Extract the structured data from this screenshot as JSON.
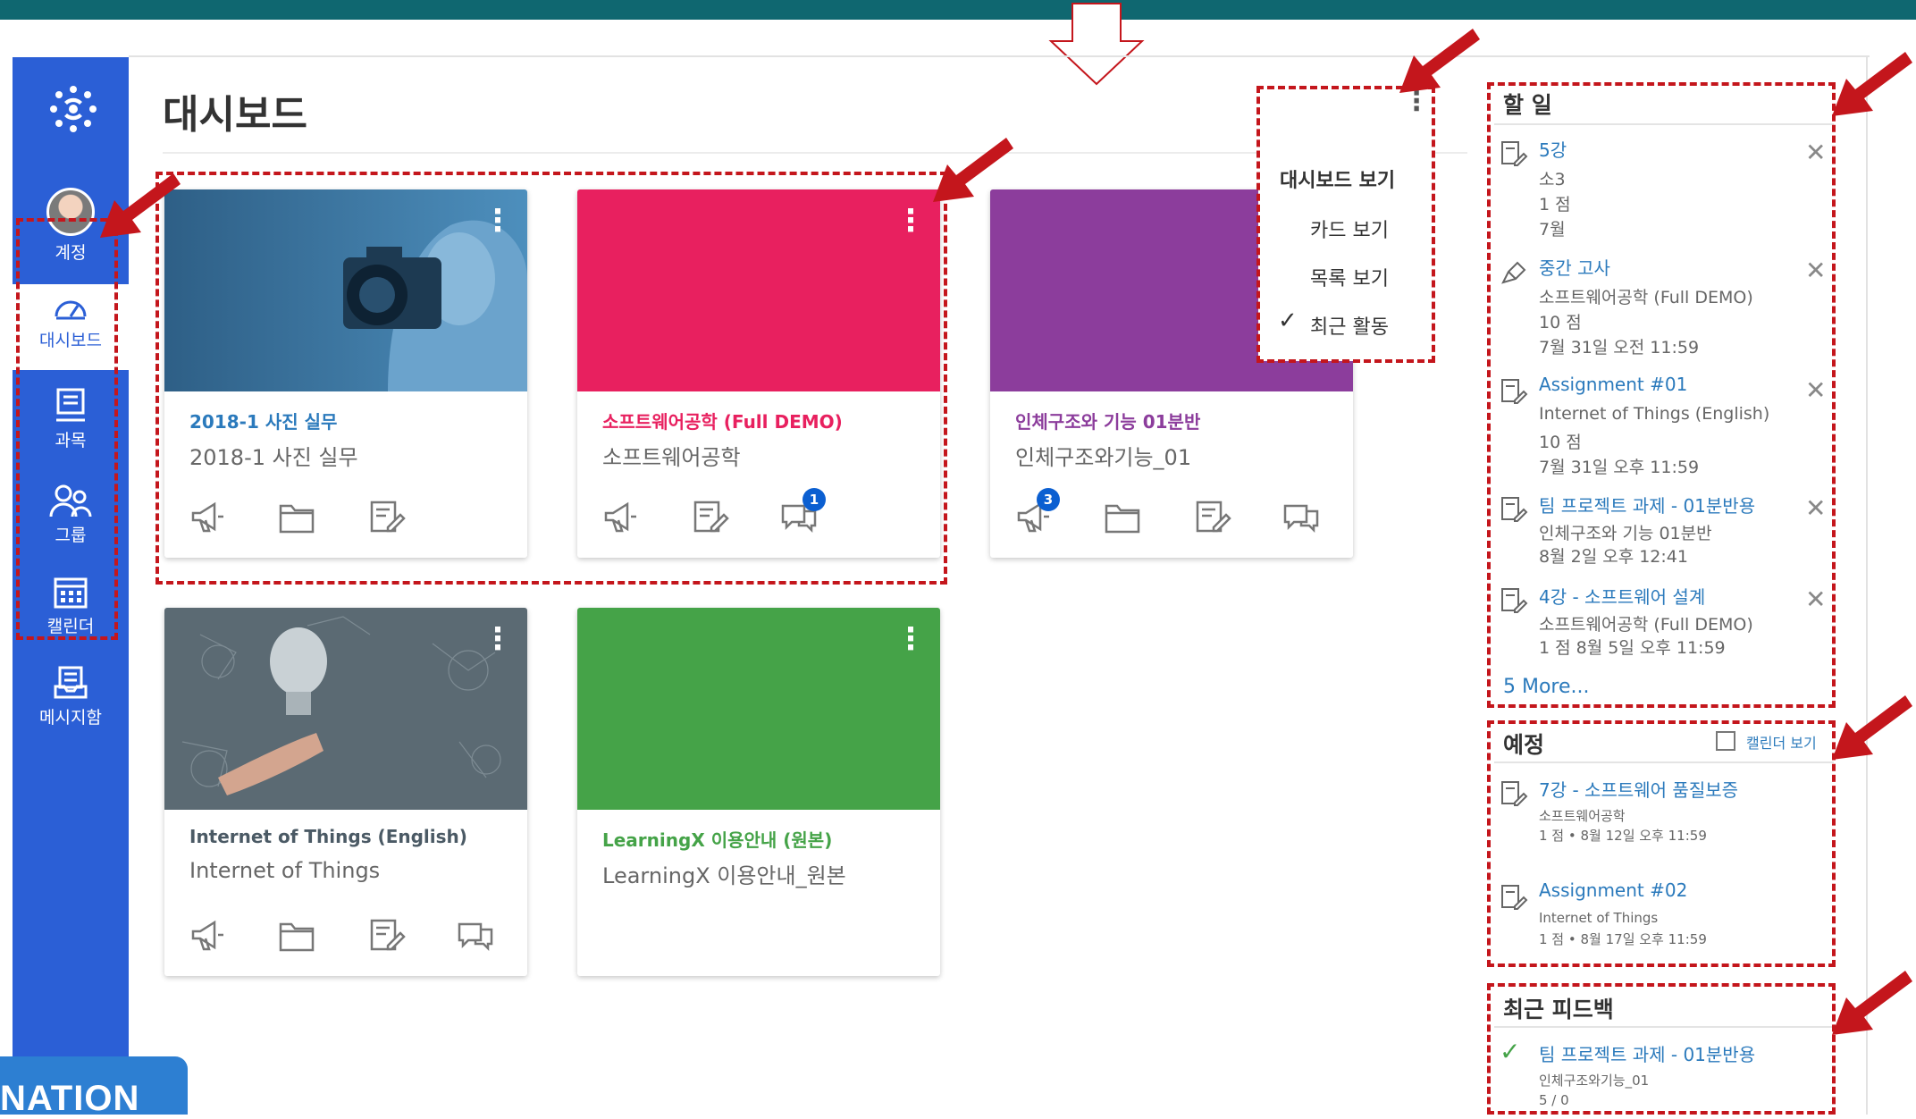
{
  "colors": {
    "top_bar": "#0f6770",
    "global_nav": "#2b5fd6",
    "card_pink": "#e8205f",
    "card_purple": "#8c3d9c",
    "card_green": "#45a348",
    "link": "#2b7abc",
    "highlight": "#c4161c"
  },
  "global_nav": {
    "items": [
      {
        "label": "계정",
        "icon": "avatar"
      },
      {
        "label": "대시보드",
        "icon": "dashboard-icon"
      },
      {
        "label": "과목",
        "icon": "courses-icon"
      },
      {
        "label": "그룹",
        "icon": "groups-icon"
      },
      {
        "label": "캘린더",
        "icon": "calendar-icon"
      },
      {
        "label": "메시지함",
        "icon": "inbox-icon"
      }
    ],
    "overlay_label": "NATION"
  },
  "page_title": "대시보드",
  "cards": [
    {
      "title": "2018-1 사진 실무",
      "subtitle": "2018-1 사진 실무",
      "title_color": "#2b7abc",
      "hero": "photo-camera",
      "icons": [
        "announcements-icon",
        "files-icon",
        "assignments-icon"
      ],
      "badge": ""
    },
    {
      "title": "소프트웨어공학 (Full DEMO)",
      "subtitle": "소프트웨어공학",
      "title_color": "#e8205f",
      "hero": "#e8205f",
      "icons": [
        "announcements-icon",
        "assignments-icon",
        "discussions-icon"
      ],
      "badge": "1"
    },
    {
      "title": "인체구조와 기능 01분반",
      "subtitle": "인체구조와기능_01",
      "title_color": "#8c3d9c",
      "hero": "#8c3d9c",
      "icons": [
        "announcements-icon",
        "files-icon",
        "assignments-icon",
        "discussions-icon"
      ],
      "badge": "3"
    },
    {
      "title": "Internet of Things (English)",
      "subtitle": "Internet of Things",
      "title_color": "#4b5a65",
      "hero": "photo-bulb",
      "icons": [
        "announcements-icon",
        "files-icon",
        "assignments-icon",
        "discussions-icon"
      ],
      "badge": ""
    },
    {
      "title": "LearningX 이용안내 (원본)",
      "subtitle": "LearningX 이용안내_원본",
      "title_color": "#45a348",
      "hero": "#45a348",
      "icons": [],
      "badge": ""
    }
  ],
  "view_menu": {
    "heading": "대시보드 보기",
    "options": [
      "카드 보기",
      "목록 보기",
      "최근 활동"
    ],
    "selected": "최근 활동"
  },
  "todo": {
    "heading": "할 일",
    "items": [
      {
        "title": "5강",
        "lines": [
          "소3",
          "1 점",
          "7월"
        ]
      },
      {
        "title": "중간 고사",
        "lines": [
          "소프트웨어공학 (Full DEMO)",
          "10 점",
          "7월 31일 오전 11:59"
        ]
      },
      {
        "title": "Assignment #01",
        "lines": [
          "Internet of Things (English)",
          "10 점",
          "7월 31일 오후 11:59"
        ]
      },
      {
        "title": "팀 프로젝트 과제 - 01분반용",
        "lines": [
          "인체구조와 기능 01분반",
          "8월 2일 오후 12:41"
        ]
      },
      {
        "title": "4강 - 소프트웨어 설계",
        "lines": [
          "소프트웨어공학 (Full DEMO)",
          "1 점    8월 5일 오후 11:59"
        ]
      }
    ],
    "more": "5 More..."
  },
  "upcoming": {
    "heading": "예정",
    "calendar_link": "캘린더 보기",
    "items": [
      {
        "title": "7강 - 소프트웨어 품질보증",
        "lines": [
          "소프트웨어공학",
          "1 점 • 8월 12일 오후 11:59"
        ]
      },
      {
        "title": "Assignment #02",
        "lines": [
          "Internet of Things",
          "1 점 • 8월 17일 오후 11:59"
        ]
      }
    ]
  },
  "feedback": {
    "heading": "최근 피드백",
    "items": [
      {
        "title": "팀 프로젝트 과제 - 01분반용",
        "lines": [
          "인체구조와기능_01",
          "5 / 0"
        ]
      }
    ]
  }
}
